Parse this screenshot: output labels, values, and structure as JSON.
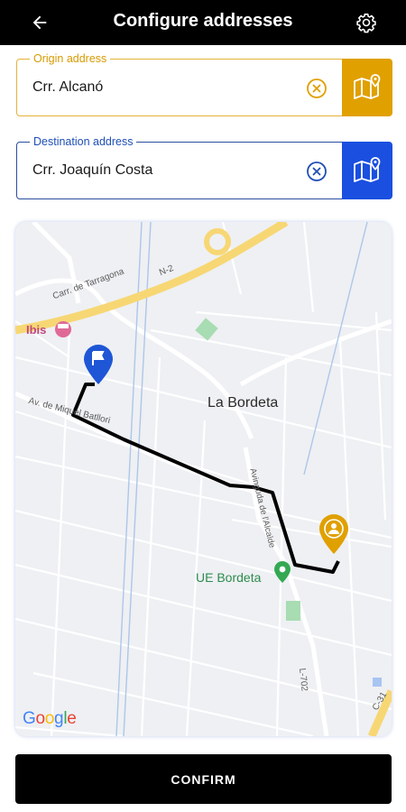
{
  "header": {
    "title": "Configure addresses",
    "back_icon": "arrow-left-icon",
    "settings_icon": "gear-icon"
  },
  "origin": {
    "label": "Origin address",
    "value": "Crr. Alcanó",
    "clear_icon": "clear-circle-icon",
    "map_icon": "map-pin-icon",
    "accent_color": "#e0a000"
  },
  "destination": {
    "label": "Destination address",
    "value": "Crr. Joaquín Costa",
    "clear_icon": "clear-circle-icon",
    "map_icon": "map-pin-icon",
    "accent_color": "#1a4fe0"
  },
  "map": {
    "place_label": "La Bordeta",
    "poi_label": "UE Bordeta",
    "hotel_label": "Ibis",
    "roads": {
      "tarragona": "Carr. de Tarragona",
      "n2": "N-2",
      "av": "Av. de Miquel Batllori",
      "avda": "Avinguda de l'Alcalde",
      "l702": "L-702",
      "c31": "C-31"
    },
    "attribution": "Google",
    "destination_marker_icon": "flag-pin-icon",
    "origin_marker_icon": "person-pin-icon",
    "route_color": "#000000"
  },
  "actions": {
    "confirm_label": "CONFIRM"
  }
}
